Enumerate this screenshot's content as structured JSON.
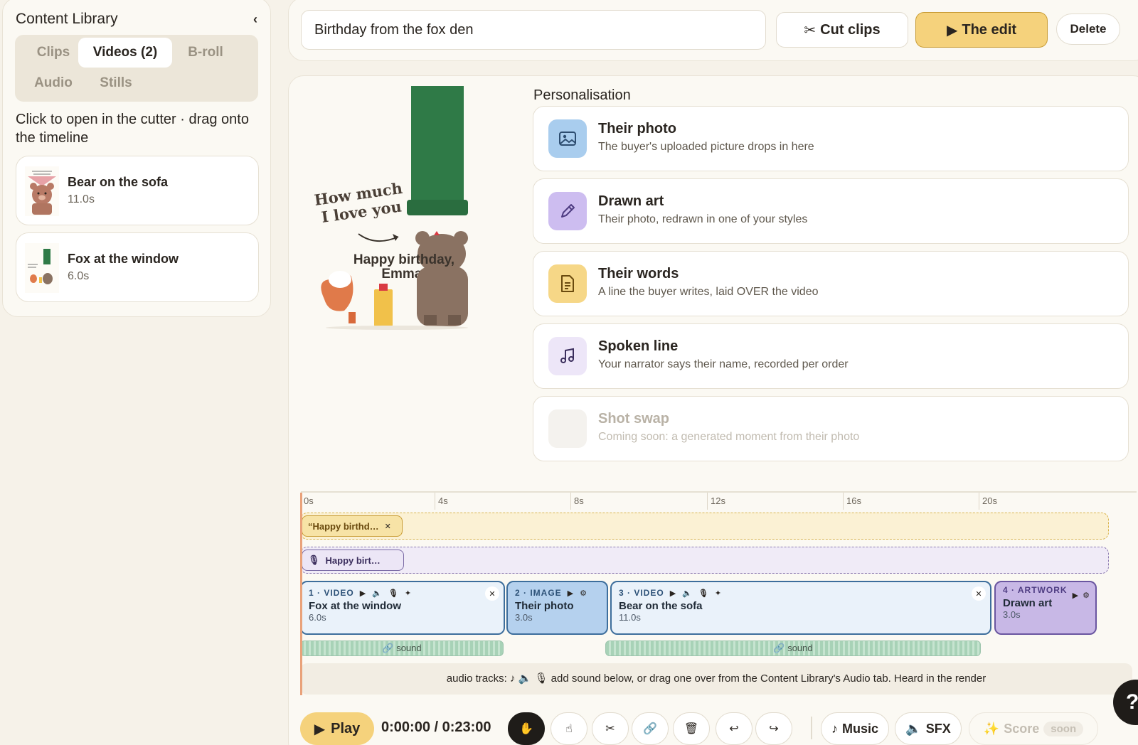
{
  "sidebar": {
    "title": "Content Library",
    "tabs": [
      "Clips",
      "Videos (2)",
      "B-roll",
      "Audio",
      "Stills"
    ],
    "active_tab": "Videos (2)",
    "hint": "Click to open in the cutter · drag onto the timeline",
    "items": [
      {
        "name": "Bear on the sofa",
        "duration": "11.0s"
      },
      {
        "name": "Fox at the window",
        "duration": "6.0s"
      }
    ]
  },
  "topbar": {
    "title_value": "Birthday from the fox den",
    "cut_label": "Cut clips",
    "edit_label": "The edit",
    "delete_label": "Delete"
  },
  "preview": {
    "headline": "How much I love you",
    "caption_line1": "Happy birthday,",
    "caption_line2": "Emma!"
  },
  "personalisation": {
    "label": "Personalisation",
    "cards": [
      {
        "title": "Their photo",
        "subtitle": "The buyer's uploaded picture drops in here",
        "icon": "image-icon",
        "color": "#a9cdee"
      },
      {
        "title": "Drawn art",
        "subtitle": "Their photo, redrawn in one of your styles",
        "icon": "pencil-icon",
        "color": "#cdbdf0"
      },
      {
        "title": "Their words",
        "subtitle": "A line the buyer writes, laid OVER the video",
        "icon": "document-icon",
        "color": "#f6d787"
      },
      {
        "title": "Spoken line",
        "subtitle": "Your narrator says their name, recorded per order",
        "icon": "music-note-icon",
        "color": "#ede6f8"
      },
      {
        "title": "Shot swap",
        "subtitle": "Coming soon: a generated moment from their photo",
        "icon": "none",
        "color": "#f4f2ee"
      }
    ]
  },
  "timeline": {
    "ticks": [
      "0s",
      "4s",
      "8s",
      "12s",
      "16s",
      "20s"
    ],
    "text_chip": "“Happy birthd…",
    "voice_chip": "Happy birt…",
    "clips": [
      {
        "kind": "1 · VIDEO",
        "name": "Fox at the window",
        "duration": "6.0s"
      },
      {
        "kind": "2 · IMAGE",
        "name": "Their photo",
        "duration": "3.0s"
      },
      {
        "kind": "3 · VIDEO",
        "name": "Bear on the sofa",
        "duration": "11.0s"
      },
      {
        "kind": "4 · ARTWORK",
        "name": "Drawn art",
        "duration": "3.0s"
      }
    ],
    "sound_label": "sound",
    "audio_hint": "audio tracks: ♪ 🔈 🎙 add sound below, or drag one over from the Content Library's Audio tab. Heard in the render"
  },
  "toolbar": {
    "play_label": "Play",
    "timecode": "0:00:00 / 0:23:00",
    "music_label": "Music",
    "sfx_label": "SFX",
    "score_label": "Score",
    "soon_label": "soon"
  },
  "help_label": "?"
}
